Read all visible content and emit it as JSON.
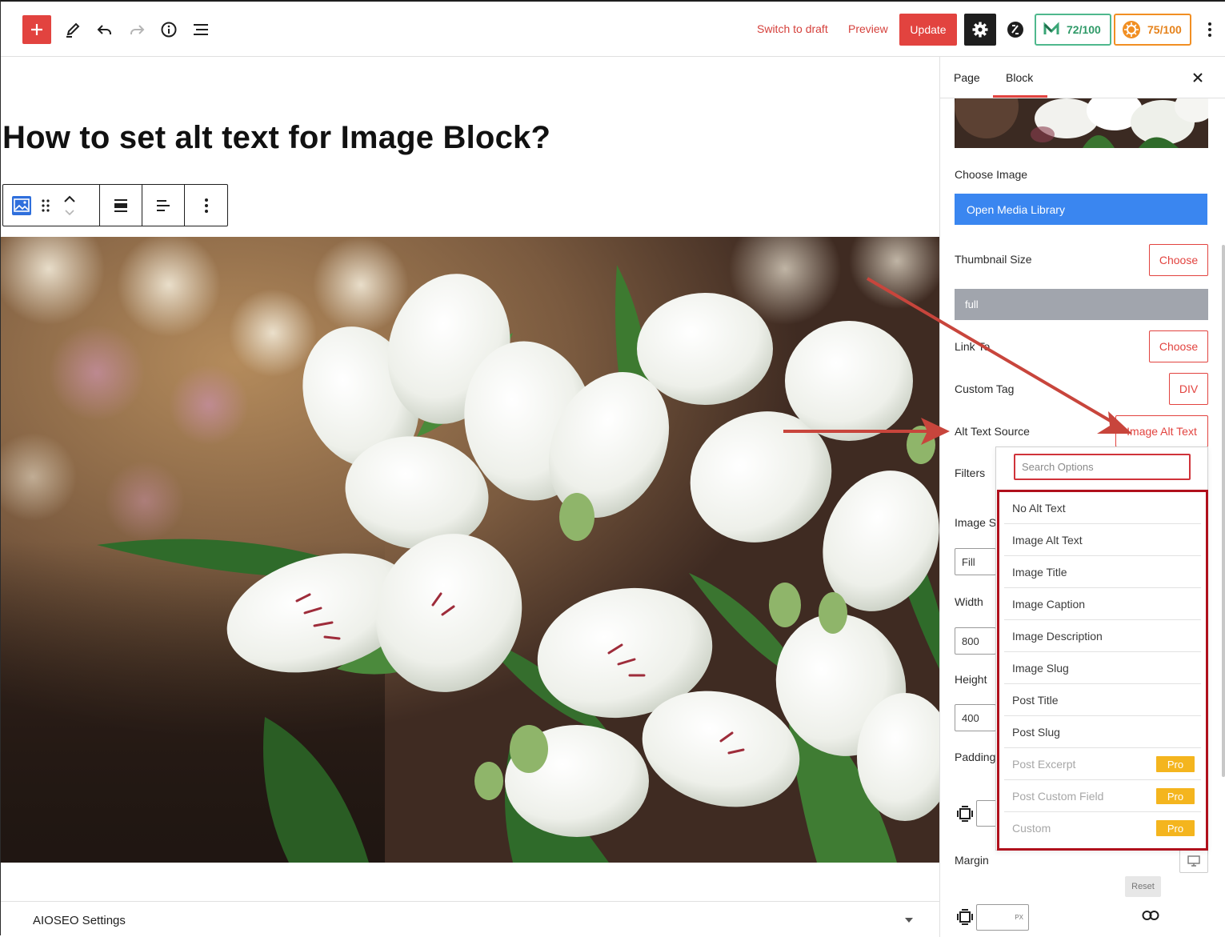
{
  "toolbar": {
    "switch_to_draft": "Switch to draft",
    "preview": "Preview",
    "update": "Update",
    "score_green": "72/100",
    "score_orange": "75/100"
  },
  "editor": {
    "title": "How to set alt text for Image Block?",
    "aioseo_label": "AIOSEO Settings"
  },
  "sidebar": {
    "tabs": {
      "page": "Page",
      "block": "Block"
    },
    "choose_image_label": "Choose Image",
    "open_media_library": "Open Media Library",
    "thumbnail_size_label": "Thumbnail Size",
    "choose_label": "Choose",
    "thumbnail_value": "full",
    "link_to_label": "Link To",
    "custom_tag_label": "Custom Tag",
    "custom_tag_value": "DIV",
    "alt_text_source_label": "Alt Text Source",
    "alt_text_source_value": "Image Alt Text",
    "filters_label": "Filters",
    "image_size_label": "Image S",
    "fit_value": "Fill",
    "width_label": "Width",
    "width_value": "800",
    "height_label": "Height",
    "height_value": "400",
    "padding_label": "Padding",
    "margin_label": "Margin",
    "reset_label": "Reset",
    "px_unit": "PX"
  },
  "dropdown": {
    "search_placeholder": "Search Options",
    "pro_label": "Pro",
    "options": [
      {
        "label": "No Alt Text",
        "pro": false
      },
      {
        "label": "Image Alt Text",
        "pro": false
      },
      {
        "label": "Image Title",
        "pro": false
      },
      {
        "label": "Image Caption",
        "pro": false
      },
      {
        "label": "Image Description",
        "pro": false
      },
      {
        "label": "Image Slug",
        "pro": false
      },
      {
        "label": "Post Title",
        "pro": false
      },
      {
        "label": "Post Slug",
        "pro": false
      },
      {
        "label": "Post Excerpt",
        "pro": true
      },
      {
        "label": "Post Custom Field",
        "pro": true
      },
      {
        "label": "Custom",
        "pro": true
      }
    ]
  },
  "colors": {
    "accent_red": "#e2433f",
    "media_blue": "#3a86f0",
    "pro_yellow": "#f4b51e",
    "score_green": "#4fb88d",
    "score_orange": "#f18f23",
    "annotation_red": "#c8453c"
  },
  "icons": [
    "plus-icon",
    "pencil-icon",
    "undo-icon",
    "redo-icon",
    "info-icon",
    "list-view-icon",
    "gear-icon",
    "zip-logo-icon",
    "seo-score-icon",
    "orange-score-icon",
    "more-vertical-icon",
    "image-block-icon",
    "drag-handle-icon",
    "move-up-down-icon",
    "align-wide-icon",
    "text-align-icon",
    "close-icon",
    "device-desktop-icon",
    "link-icon",
    "box-spacing-icon"
  ]
}
